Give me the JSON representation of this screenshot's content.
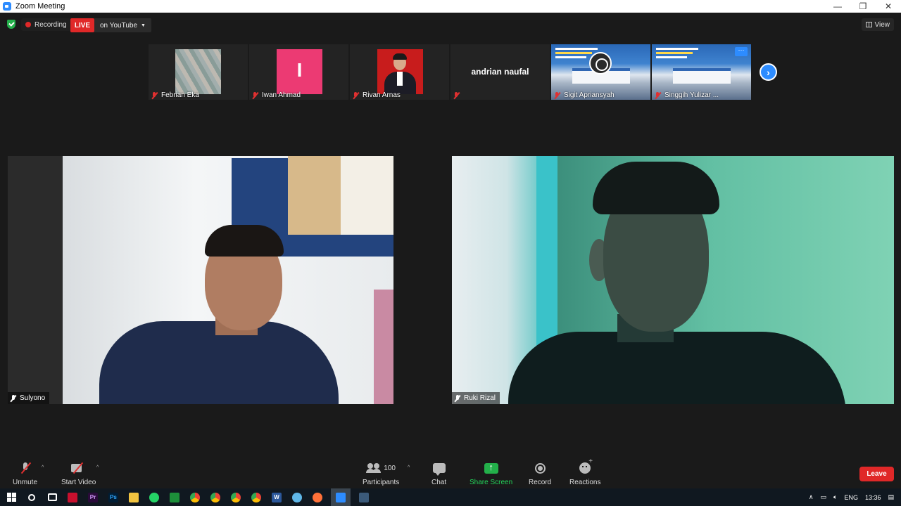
{
  "window": {
    "title": "Zoom Meeting",
    "controls": [
      "—",
      "❐",
      "✕"
    ]
  },
  "topbar": {
    "recording_label": "Recording",
    "live_label": "LIVE",
    "stream_target": "on YouTube",
    "view_label": "View"
  },
  "thumbnails": [
    {
      "name": "Febrian Eka",
      "muted": true
    },
    {
      "name": "Iwan Ahmad",
      "muted": true,
      "avatar_letter": "I"
    },
    {
      "name": "Rivan Arnas",
      "muted": true
    },
    {
      "name": "andrian naufal",
      "muted": true
    },
    {
      "name": "Sigit Apriansyah",
      "muted": true
    },
    {
      "name": "Singgih Yulizar ...",
      "muted": true,
      "menu": "···"
    }
  ],
  "next_page_icon": "›",
  "videos": [
    {
      "name": "Sulyono",
      "muted": true
    },
    {
      "name": "Ruki Rizal",
      "muted": true
    }
  ],
  "toolbar": {
    "unmute": "Unmute",
    "start_video": "Start Video",
    "participants": "Participants",
    "participants_count": "100",
    "chat": "Chat",
    "share_screen": "Share Screen",
    "record": "Record",
    "reactions": "Reactions",
    "leave": "Leave",
    "caret": "^"
  },
  "taskbar": {
    "apps": [
      "start",
      "search",
      "task-view",
      "app-red",
      "premiere",
      "photoshop",
      "file-explorer",
      "whatsapp",
      "excel-green",
      "chrome",
      "chrome-2",
      "chrome-3",
      "chrome-4",
      "word",
      "edge-like",
      "firefox",
      "zoom",
      "notepad"
    ],
    "premiere_label": "Pr",
    "photoshop_label": "Ps",
    "word_label": "W",
    "language": "ENG",
    "time": "13:36"
  },
  "colors": {
    "accent": "#2d8cff",
    "live_red": "#e02828",
    "share_green": "#23b04a",
    "background": "#1a1a1a"
  }
}
